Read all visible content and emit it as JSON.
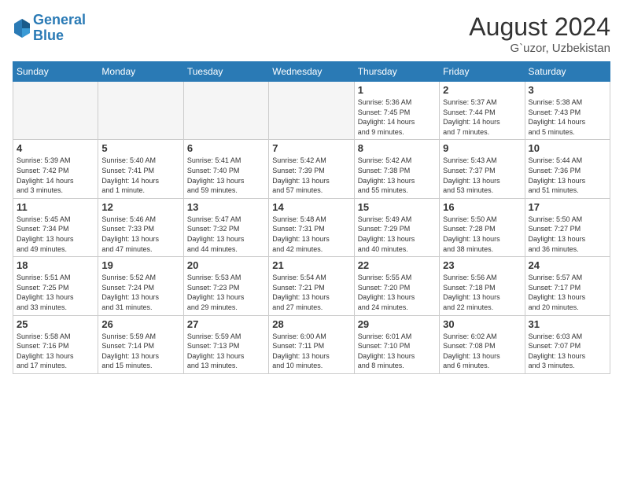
{
  "logo": {
    "line1": "General",
    "line2": "Blue"
  },
  "title": "August 2024",
  "location": "G`uzor, Uzbekistan",
  "days_of_week": [
    "Sunday",
    "Monday",
    "Tuesday",
    "Wednesday",
    "Thursday",
    "Friday",
    "Saturday"
  ],
  "weeks": [
    [
      {
        "day": "",
        "info": ""
      },
      {
        "day": "",
        "info": ""
      },
      {
        "day": "",
        "info": ""
      },
      {
        "day": "",
        "info": ""
      },
      {
        "day": "1",
        "info": "Sunrise: 5:36 AM\nSunset: 7:45 PM\nDaylight: 14 hours\nand 9 minutes."
      },
      {
        "day": "2",
        "info": "Sunrise: 5:37 AM\nSunset: 7:44 PM\nDaylight: 14 hours\nand 7 minutes."
      },
      {
        "day": "3",
        "info": "Sunrise: 5:38 AM\nSunset: 7:43 PM\nDaylight: 14 hours\nand 5 minutes."
      }
    ],
    [
      {
        "day": "4",
        "info": "Sunrise: 5:39 AM\nSunset: 7:42 PM\nDaylight: 14 hours\nand 3 minutes."
      },
      {
        "day": "5",
        "info": "Sunrise: 5:40 AM\nSunset: 7:41 PM\nDaylight: 14 hours\nand 1 minute."
      },
      {
        "day": "6",
        "info": "Sunrise: 5:41 AM\nSunset: 7:40 PM\nDaylight: 13 hours\nand 59 minutes."
      },
      {
        "day": "7",
        "info": "Sunrise: 5:42 AM\nSunset: 7:39 PM\nDaylight: 13 hours\nand 57 minutes."
      },
      {
        "day": "8",
        "info": "Sunrise: 5:42 AM\nSunset: 7:38 PM\nDaylight: 13 hours\nand 55 minutes."
      },
      {
        "day": "9",
        "info": "Sunrise: 5:43 AM\nSunset: 7:37 PM\nDaylight: 13 hours\nand 53 minutes."
      },
      {
        "day": "10",
        "info": "Sunrise: 5:44 AM\nSunset: 7:36 PM\nDaylight: 13 hours\nand 51 minutes."
      }
    ],
    [
      {
        "day": "11",
        "info": "Sunrise: 5:45 AM\nSunset: 7:34 PM\nDaylight: 13 hours\nand 49 minutes."
      },
      {
        "day": "12",
        "info": "Sunrise: 5:46 AM\nSunset: 7:33 PM\nDaylight: 13 hours\nand 47 minutes."
      },
      {
        "day": "13",
        "info": "Sunrise: 5:47 AM\nSunset: 7:32 PM\nDaylight: 13 hours\nand 44 minutes."
      },
      {
        "day": "14",
        "info": "Sunrise: 5:48 AM\nSunset: 7:31 PM\nDaylight: 13 hours\nand 42 minutes."
      },
      {
        "day": "15",
        "info": "Sunrise: 5:49 AM\nSunset: 7:29 PM\nDaylight: 13 hours\nand 40 minutes."
      },
      {
        "day": "16",
        "info": "Sunrise: 5:50 AM\nSunset: 7:28 PM\nDaylight: 13 hours\nand 38 minutes."
      },
      {
        "day": "17",
        "info": "Sunrise: 5:50 AM\nSunset: 7:27 PM\nDaylight: 13 hours\nand 36 minutes."
      }
    ],
    [
      {
        "day": "18",
        "info": "Sunrise: 5:51 AM\nSunset: 7:25 PM\nDaylight: 13 hours\nand 33 minutes."
      },
      {
        "day": "19",
        "info": "Sunrise: 5:52 AM\nSunset: 7:24 PM\nDaylight: 13 hours\nand 31 minutes."
      },
      {
        "day": "20",
        "info": "Sunrise: 5:53 AM\nSunset: 7:23 PM\nDaylight: 13 hours\nand 29 minutes."
      },
      {
        "day": "21",
        "info": "Sunrise: 5:54 AM\nSunset: 7:21 PM\nDaylight: 13 hours\nand 27 minutes."
      },
      {
        "day": "22",
        "info": "Sunrise: 5:55 AM\nSunset: 7:20 PM\nDaylight: 13 hours\nand 24 minutes."
      },
      {
        "day": "23",
        "info": "Sunrise: 5:56 AM\nSunset: 7:18 PM\nDaylight: 13 hours\nand 22 minutes."
      },
      {
        "day": "24",
        "info": "Sunrise: 5:57 AM\nSunset: 7:17 PM\nDaylight: 13 hours\nand 20 minutes."
      }
    ],
    [
      {
        "day": "25",
        "info": "Sunrise: 5:58 AM\nSunset: 7:16 PM\nDaylight: 13 hours\nand 17 minutes."
      },
      {
        "day": "26",
        "info": "Sunrise: 5:59 AM\nSunset: 7:14 PM\nDaylight: 13 hours\nand 15 minutes."
      },
      {
        "day": "27",
        "info": "Sunrise: 5:59 AM\nSunset: 7:13 PM\nDaylight: 13 hours\nand 13 minutes."
      },
      {
        "day": "28",
        "info": "Sunrise: 6:00 AM\nSunset: 7:11 PM\nDaylight: 13 hours\nand 10 minutes."
      },
      {
        "day": "29",
        "info": "Sunrise: 6:01 AM\nSunset: 7:10 PM\nDaylight: 13 hours\nand 8 minutes."
      },
      {
        "day": "30",
        "info": "Sunrise: 6:02 AM\nSunset: 7:08 PM\nDaylight: 13 hours\nand 6 minutes."
      },
      {
        "day": "31",
        "info": "Sunrise: 6:03 AM\nSunset: 7:07 PM\nDaylight: 13 hours\nand 3 minutes."
      }
    ]
  ]
}
